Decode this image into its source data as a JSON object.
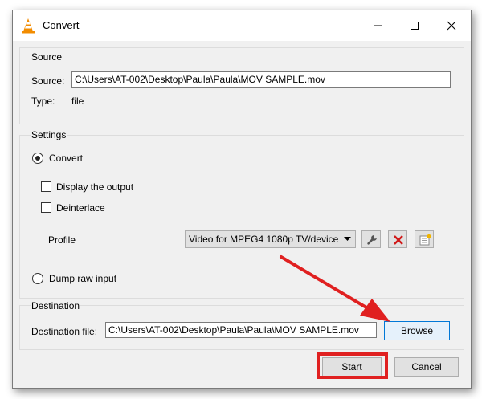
{
  "window": {
    "title": "Convert",
    "icon": "vlc-cone-icon",
    "controls": {
      "minimize": "minimize-icon",
      "maximize": "maximize-icon",
      "close": "close-icon"
    }
  },
  "source": {
    "group_label": "Source",
    "source_label": "Source:",
    "source_value": "C:\\Users\\AT-002\\Desktop\\Paula\\Paula\\MOV SAMPLE.mov",
    "type_label": "Type:",
    "type_value": "file"
  },
  "settings": {
    "group_label": "Settings",
    "convert_label": "Convert",
    "convert_selected": true,
    "display_output_label": "Display the output",
    "display_output_checked": false,
    "deinterlace_label": "Deinterlace",
    "deinterlace_checked": false,
    "profile_label": "Profile",
    "profile_value": "Video for MPEG4 1080p TV/device",
    "edit_profile_icon": "wrench-icon",
    "delete_profile_icon": "delete-x-icon",
    "new_profile_icon": "new-profile-icon",
    "dump_raw_label": "Dump raw input",
    "dump_raw_selected": false
  },
  "destination": {
    "group_label": "Destination",
    "file_label": "Destination file:",
    "file_value": "C:\\Users\\AT-002\\Desktop\\Paula\\Paula\\MOV SAMPLE.mov",
    "browse_label": "Browse"
  },
  "buttons": {
    "start_label": "Start",
    "cancel_label": "Cancel"
  },
  "colors": {
    "annotation_red": "#e02020",
    "focus_blue": "#0078d7"
  }
}
